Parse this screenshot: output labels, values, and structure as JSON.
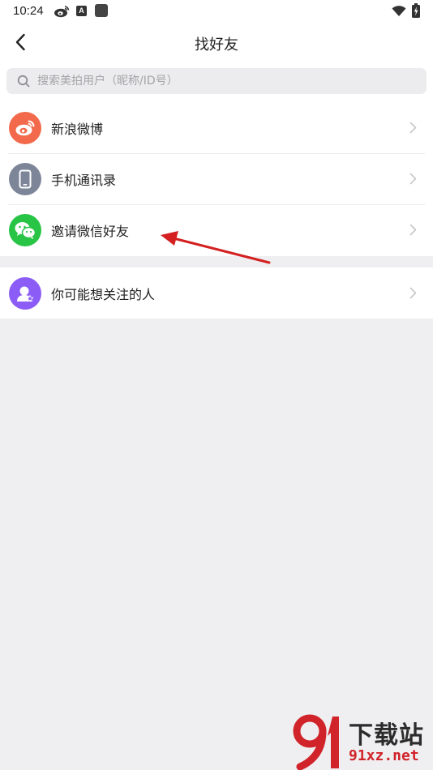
{
  "status_bar": {
    "time": "10:24",
    "badge_letter": "A"
  },
  "header": {
    "title": "找好友"
  },
  "search": {
    "placeholder": "搜索美拍用户（昵称/ID号）"
  },
  "list": {
    "items": [
      {
        "label": "新浪微博",
        "icon": "weibo-icon",
        "color": "#f26a4b"
      },
      {
        "label": "手机通讯录",
        "icon": "phone-icon",
        "color": "#7d8699"
      },
      {
        "label": "邀请微信好友",
        "icon": "wechat-icon",
        "color": "#28c445"
      }
    ],
    "suggest": {
      "label": "你可能想关注的人",
      "icon": "user-star-icon",
      "color": "#8b5cf6"
    }
  },
  "annotation": {
    "arrow_color": "#d42020"
  },
  "watermark": {
    "title": "下载站",
    "url": "91xz.net"
  }
}
